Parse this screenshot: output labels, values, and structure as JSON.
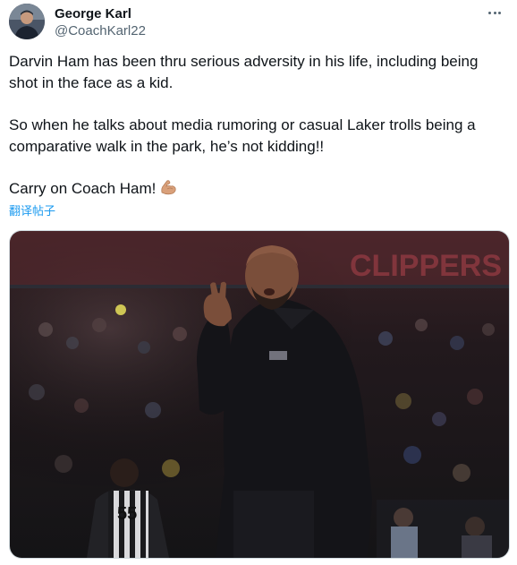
{
  "author": {
    "name": "George Karl",
    "handle": "@CoachKarl22"
  },
  "tweet": {
    "paragraphs": [
      "Darvin Ham has been thru serious adversity in his life, including being shot in the face as a kid.",
      "So when he talks about media rumoring or casual Laker trolls being a comparative walk in the park, he’s not kidding!!",
      "Carry on Coach Ham!"
    ],
    "emoji": "flexed-biceps-icon",
    "translate_label": "翻译帖子"
  },
  "media": {
    "arena_sign": "CLIPPERS",
    "jersey_number": "55"
  },
  "colors": {
    "text": "#0f1419",
    "secondary": "#536471",
    "link": "#1d9bf0"
  }
}
